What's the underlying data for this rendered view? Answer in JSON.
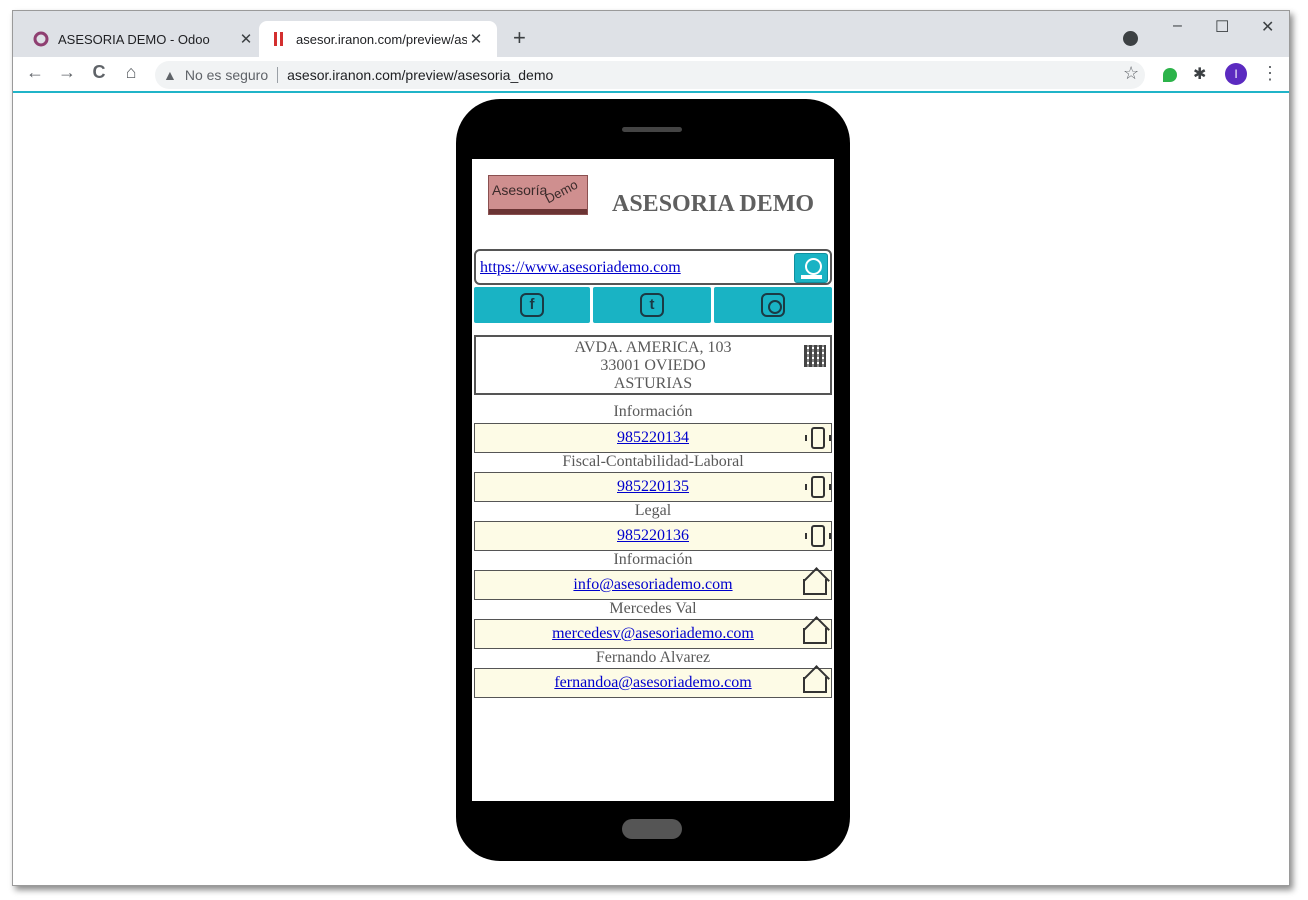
{
  "browser": {
    "tabs": [
      {
        "title": "ASESORIA DEMO - Odoo",
        "close": "✕"
      },
      {
        "title": "asesor.iranon.com/preview/asesoria_demo",
        "close": "✕"
      }
    ],
    "new_tab": "+",
    "window_controls": {
      "minimize": "–",
      "maximize": "☐",
      "close": "✕"
    },
    "toolbar": {
      "back": "←",
      "forward": "→",
      "reload": "C",
      "home": "⌂",
      "security_icon": "▲",
      "security_text": "No es seguro",
      "url": "asesor.iranon.com/preview/asesoria_demo",
      "bookmark": "☆",
      "profile_initial": "I",
      "menu": "⋮"
    }
  },
  "card": {
    "logo": {
      "line1": "Asesoría",
      "line2": "Demo"
    },
    "company_name": "ASESORIA DEMO",
    "website": "https://www.asesoriademo.com",
    "social": [
      {
        "name": "facebook",
        "glyph": "f"
      },
      {
        "name": "twitter",
        "glyph": "t"
      },
      {
        "name": "instagram",
        "glyph": ""
      }
    ],
    "address": [
      "AVDA. AMERICA, 103",
      "33001 OVIEDO",
      "ASTURIAS"
    ],
    "phones": [
      {
        "label": "Información",
        "value": "985220134"
      },
      {
        "label": "Fiscal-Contabilidad-Laboral",
        "value": "985220135"
      },
      {
        "label": "Legal",
        "value": "985220136"
      }
    ],
    "emails": [
      {
        "label": "Información",
        "value": "info@asesoriademo.com"
      },
      {
        "label": "Mercedes Val",
        "value": "mercedesv@asesoriademo.com"
      },
      {
        "label": "Fernando Alvarez",
        "value": "fernandoa@asesoriademo.com"
      }
    ]
  },
  "colors": {
    "accent": "#19b3c4",
    "contact_bg": "#fdfbe6",
    "link": "#0000cc"
  }
}
